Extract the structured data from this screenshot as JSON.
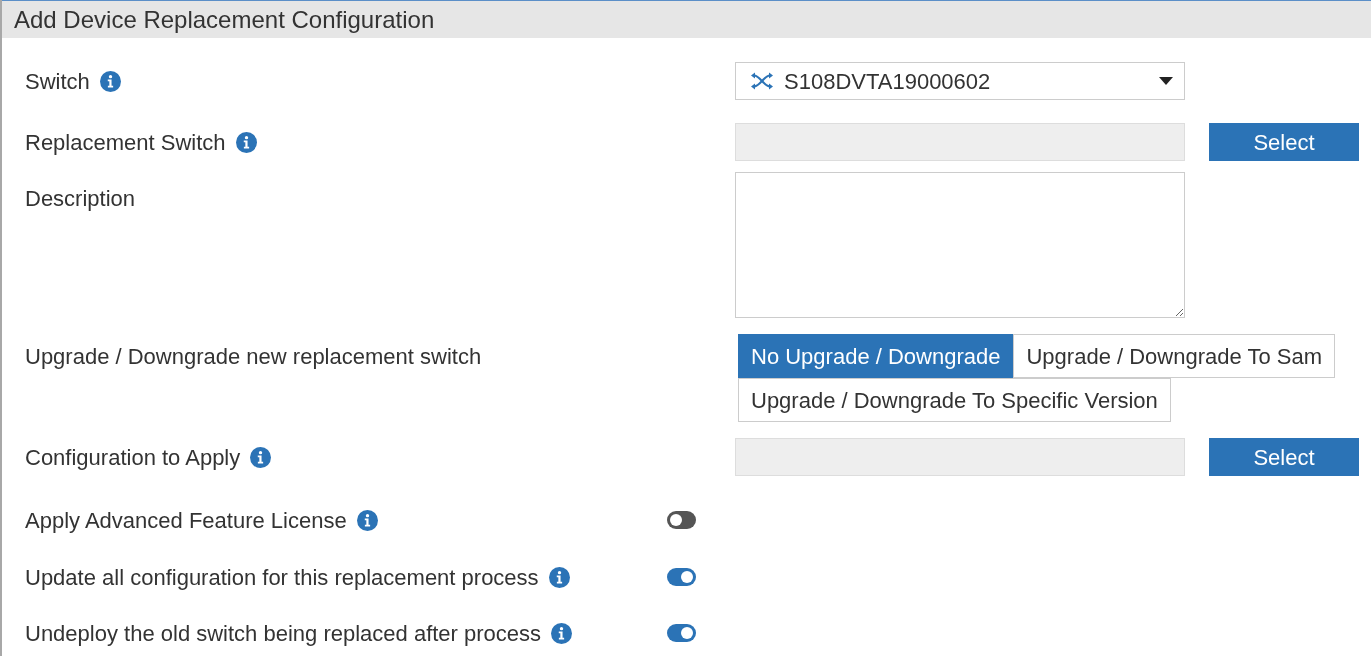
{
  "dialog": {
    "title": "Add Device Replacement Configuration"
  },
  "fields": [
    {
      "kind": "dropdown",
      "label": "Switch",
      "info": true,
      "value": "S108DVTA19000602"
    },
    {
      "kind": "picker",
      "label": "Replacement Switch",
      "info": true,
      "button": "Select"
    },
    {
      "kind": "textarea",
      "label": "Description",
      "info": false
    },
    {
      "kind": "segmented",
      "label": "Upgrade / Downgrade new replacement switch",
      "info": false,
      "options": [
        {
          "label": "No Upgrade / Downgrade",
          "selected": true
        },
        {
          "label": "Upgrade / Downgrade To Sam",
          "selected": false
        },
        {
          "label": "Upgrade / Downgrade To Specific Version",
          "selected": false
        }
      ]
    },
    {
      "kind": "picker",
      "label": "Configuration to Apply",
      "info": true,
      "button": "Select"
    },
    {
      "kind": "toggle",
      "label": "Apply Advanced Feature License",
      "info": true,
      "on": false
    },
    {
      "kind": "toggle",
      "label": "Update all configuration for this replacement process",
      "info": true,
      "on": true
    },
    {
      "kind": "toggle",
      "label": "Undeploy the old switch being replaced after process",
      "info": true,
      "on": true
    }
  ]
}
